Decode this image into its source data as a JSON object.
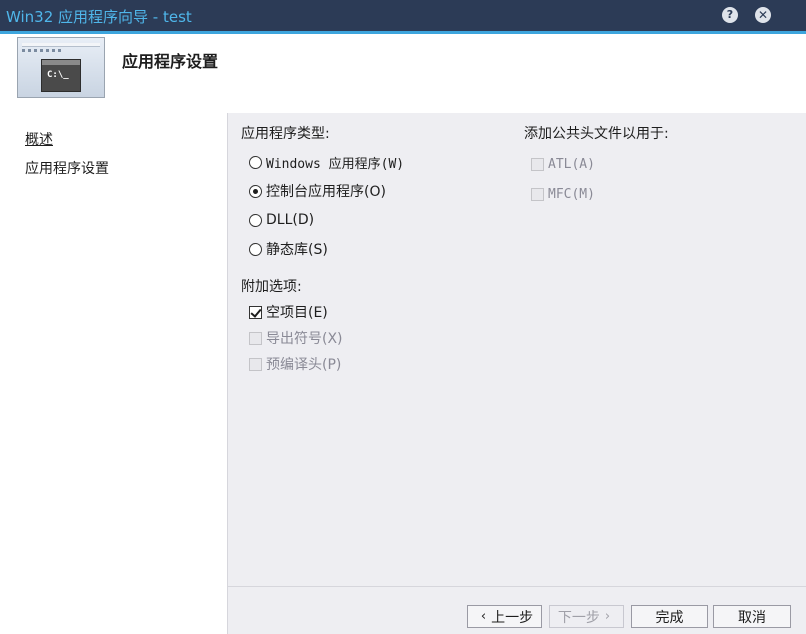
{
  "window": {
    "title": "Win32 应用程序向导 - test",
    "help_icon": "?",
    "close_icon": "✕"
  },
  "header": {
    "title": "应用程序设置",
    "logo_console_text": "C:\\_"
  },
  "sidebar": {
    "items": [
      {
        "label": "概述",
        "active": true
      },
      {
        "label": "应用程序设置",
        "active": false
      }
    ]
  },
  "app_type": {
    "label": "应用程序类型:",
    "options": [
      {
        "label": "Windows 应用程序(W)",
        "selected": false
      },
      {
        "label": "控制台应用程序(O)",
        "selected": true
      },
      {
        "label": "DLL(D)",
        "selected": false
      },
      {
        "label": "静态库(S)",
        "selected": false
      }
    ]
  },
  "additional": {
    "label": "附加选项:",
    "options": [
      {
        "label": "空项目(E)",
        "checked": true,
        "enabled": true
      },
      {
        "label": "导出符号(X)",
        "checked": false,
        "enabled": false
      },
      {
        "label": "预编译头(P)",
        "checked": false,
        "enabled": false
      }
    ]
  },
  "common_headers": {
    "label": "添加公共头文件以用于:",
    "options": [
      {
        "label": "ATL(A)",
        "checked": false,
        "enabled": false
      },
      {
        "label": "MFC(M)",
        "checked": false,
        "enabled": false
      }
    ]
  },
  "footer": {
    "prev_label": "上一步",
    "next_label": "下一步",
    "finish_label": "完成",
    "cancel_label": "取消"
  },
  "colors": {
    "titlebar": "#2c3b56",
    "title_text": "#4fb6ea",
    "accent": "#3da5dd",
    "panel": "#eeeef2"
  }
}
